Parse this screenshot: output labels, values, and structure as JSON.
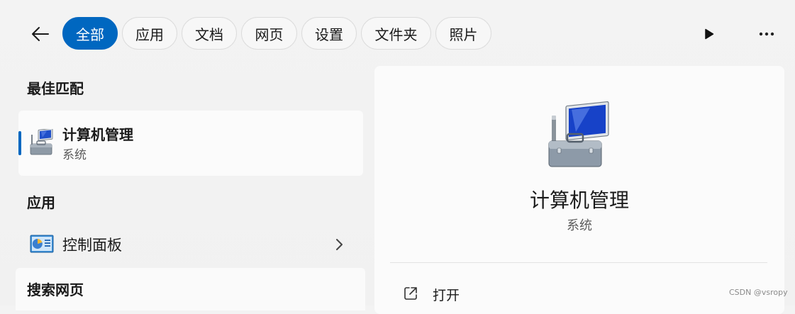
{
  "filters": {
    "chips": [
      {
        "label": "全部",
        "active": true
      },
      {
        "label": "应用",
        "active": false
      },
      {
        "label": "文档",
        "active": false
      },
      {
        "label": "网页",
        "active": false
      },
      {
        "label": "设置",
        "active": false
      },
      {
        "label": "文件夹",
        "active": false
      },
      {
        "label": "照片",
        "active": false
      }
    ]
  },
  "icons": {
    "back": "arrow-left-icon",
    "play": "play-icon",
    "more": "more-horizontal-icon",
    "chevron": "chevron-right-icon",
    "open": "open-external-icon"
  },
  "results": {
    "best_match_title": "最佳匹配",
    "best_match": {
      "name": "计算机管理",
      "category": "系统",
      "icon": "computer-management-icon"
    },
    "apps_title": "应用",
    "apps": [
      {
        "name": "控制面板",
        "icon": "control-panel-icon"
      }
    ],
    "web_title": "搜索网页"
  },
  "preview": {
    "name": "计算机管理",
    "category": "系统",
    "icon": "computer-management-icon",
    "actions": [
      {
        "label": "打开",
        "icon": "open-external-icon"
      }
    ]
  },
  "watermark": "CSDN @vsropy",
  "colors": {
    "accent": "#0067c0",
    "background": "#f3f3f3",
    "panel": "#fbfbfb"
  }
}
